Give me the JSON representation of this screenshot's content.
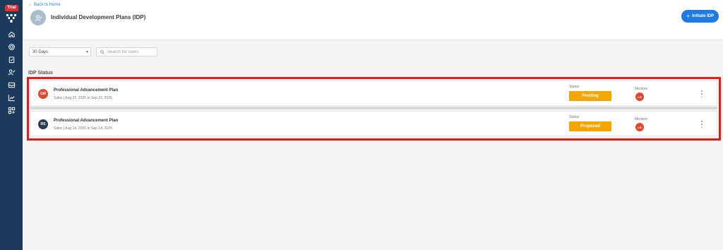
{
  "sidebar": {
    "trial_badge": "Trial",
    "bg_color": "#1b3a5c",
    "icons": [
      "logo-icon",
      "home-icon",
      "target-icon",
      "clipboard-icon",
      "user-edit-icon",
      "inbox-icon",
      "chart-icon",
      "apps-icon"
    ]
  },
  "header": {
    "back_link": "Back to Home",
    "title": "Individual Development Plans (IDP)",
    "initiate_button": "Initiate IDP",
    "accent_color": "#1e7be6"
  },
  "filters": {
    "period_selected": "30 Days",
    "search_placeholder": "Search for users"
  },
  "section": {
    "title": "IDP Status"
  },
  "labels": {
    "status": "Status",
    "mentors": "Mentors"
  },
  "idps": [
    {
      "initials": "GM",
      "avatar_color": "#e4452e",
      "title": "Professional Advancement Plan",
      "subtitle": "Sales | Aug 22, 2025 to Sep 22, 2025",
      "status": "Pending",
      "mentor_initials": "LR"
    },
    {
      "initials": "RS",
      "avatar_color": "#2e3d4e",
      "title": "Professional Advancement Plan",
      "subtitle": "Sales | Aug 14, 2025 to Sep 14, 2025",
      "status": "Proposed",
      "mentor_initials": "LR"
    }
  ],
  "status_color": "#f5a500",
  "highlight_color": "#e01e1e"
}
